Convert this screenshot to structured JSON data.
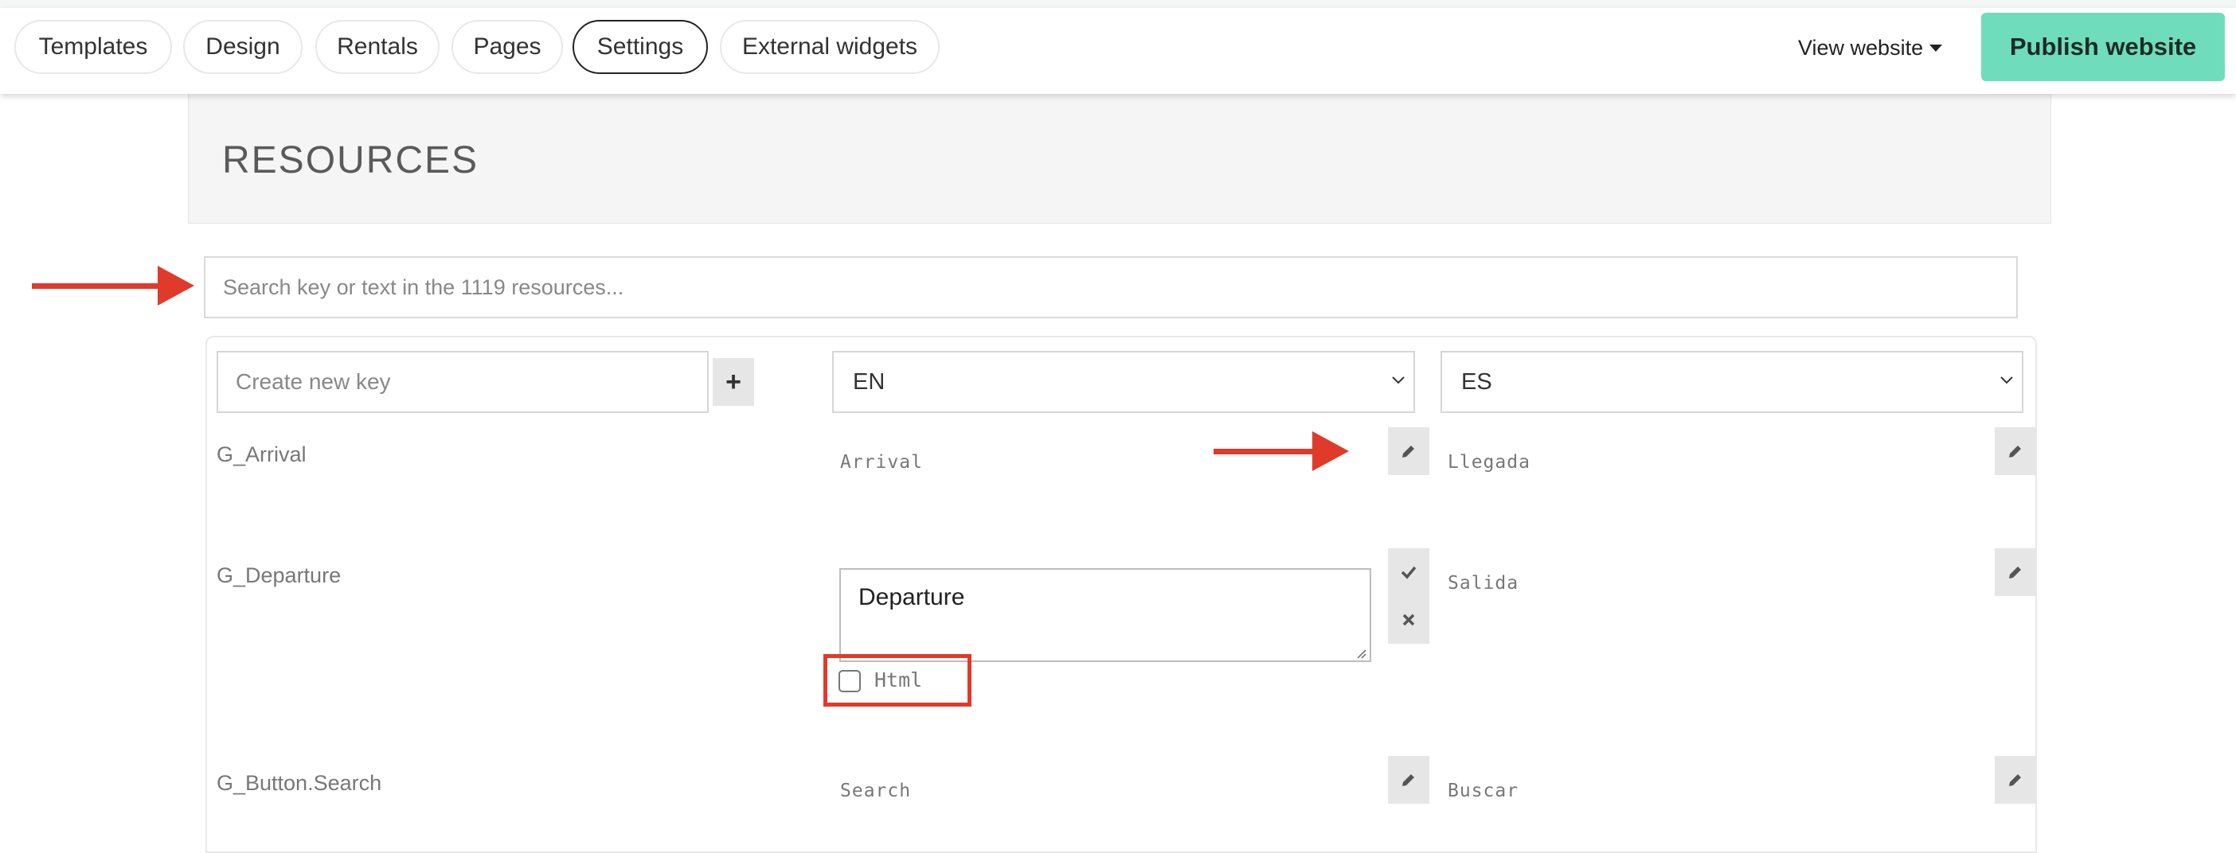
{
  "topbar": {
    "tabs": [
      {
        "label": "Templates",
        "active": false
      },
      {
        "label": "Design",
        "active": false
      },
      {
        "label": "Rentals",
        "active": false
      },
      {
        "label": "Pages",
        "active": false
      },
      {
        "label": "Settings",
        "active": true
      },
      {
        "label": "External widgets",
        "active": false
      }
    ],
    "view_website": "View website",
    "publish_label": "Publish website",
    "publish_color": "#6fdcbb"
  },
  "resources": {
    "title": "RESOURCES",
    "search_placeholder": "Search key or text in the 1119 resources...",
    "new_key_placeholder": "Create new key",
    "lang_left": "EN",
    "lang_right": "ES",
    "rows": [
      {
        "key": "G_Arrival",
        "en": "Arrival",
        "es": "Llegada"
      },
      {
        "key": "G_Departure",
        "en": "Departure",
        "es": "Salida",
        "html_label": "Html",
        "html_checked": false
      },
      {
        "key": "G_Button.Search",
        "en": "Search",
        "es": "Buscar"
      }
    ]
  },
  "annotation_color": "#e03a2a"
}
